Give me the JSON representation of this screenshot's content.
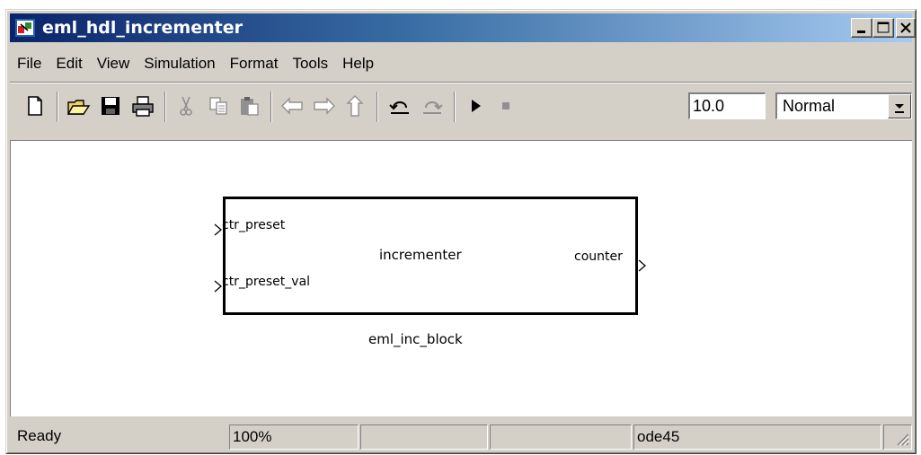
{
  "window": {
    "title": "eml_hdl_incrementer",
    "controls": [
      "minimize-icon",
      "maximize-icon",
      "close-icon"
    ]
  },
  "menubar": {
    "items": [
      "File",
      "Edit",
      "View",
      "Simulation",
      "Format",
      "Tools",
      "Help"
    ]
  },
  "toolbar": {
    "buttons": [
      "new-file-icon",
      "open-folder-icon",
      "save-icon",
      "print-icon",
      "cut-icon",
      "copy-icon",
      "paste-icon",
      "back-arrow-icon",
      "forward-arrow-icon",
      "up-arrow-icon",
      "undo-icon",
      "redo-icon",
      "play-icon",
      "stop-icon"
    ],
    "stop_time": "10.0",
    "simulation_mode": "Normal"
  },
  "canvas": {
    "block": {
      "name": "incrementer",
      "label": "eml_inc_block",
      "inputs": [
        "ctr_preset",
        "ctr_preset_val"
      ],
      "outputs": [
        "counter"
      ]
    }
  },
  "statusbar": {
    "status": "Ready",
    "zoom": "100%",
    "solver": "ode45"
  }
}
